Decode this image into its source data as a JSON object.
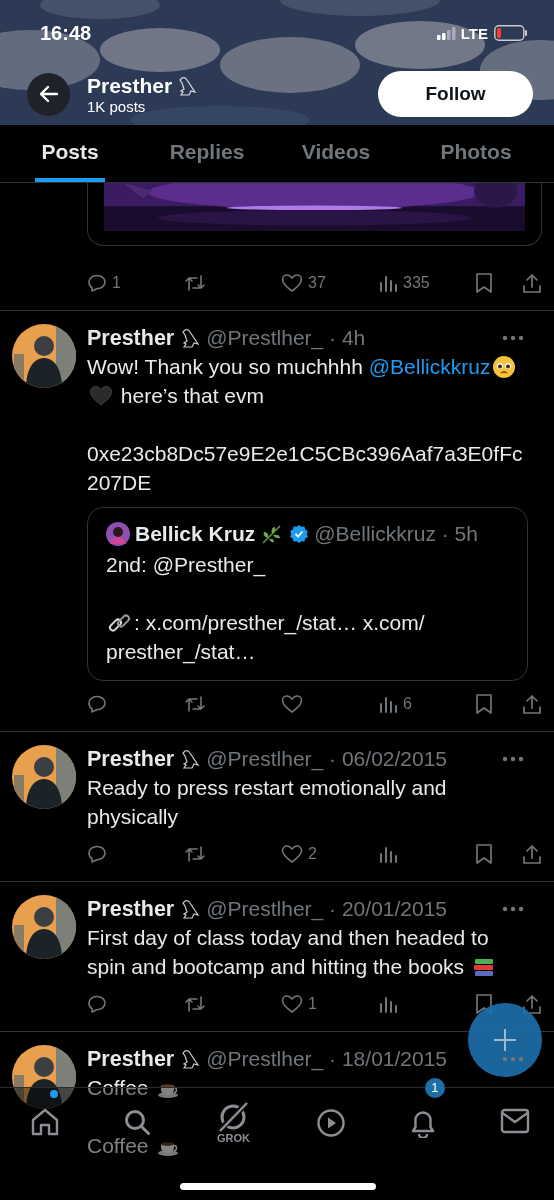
{
  "status_bar": {
    "time": "16:48",
    "network": "LTE"
  },
  "header": {
    "name": "Presther",
    "subtitle": "1K posts",
    "follow_button": "Follow"
  },
  "tabs": [
    {
      "label": "Posts",
      "selected": true
    },
    {
      "label": "Replies",
      "selected": false
    },
    {
      "label": "Videos",
      "selected": false
    },
    {
      "label": "Photos",
      "selected": false
    }
  ],
  "posts": [
    {
      "kind": "media_tail",
      "counts": {
        "reply": "1",
        "like": "37",
        "views": "335"
      }
    },
    {
      "kind": "post",
      "name": "Presther",
      "handle": "@Prestlher_",
      "separator": "·",
      "time": "4h",
      "paragraphs": [
        [
          {
            "kind": "text",
            "text": "Wow! Thank you so muchhhh "
          },
          {
            "kind": "mention",
            "text": "@Bellickkruz"
          },
          {
            "kind": "emoji"
          },
          {
            "kind": "emoji"
          },
          {
            "kind": "text",
            "text": " here’s that evm"
          }
        ],
        [
          {
            "kind": "text",
            "text": "0xe23cb8Dc57e9E2e1C5CBc396Aaf7a3E0fFc207DE"
          }
        ]
      ],
      "quote": {
        "name": "Bellick Kruz",
        "verified": true,
        "handle": "@Bellickkruz",
        "separator": "·",
        "time": "5h",
        "paragraphs": [
          [
            {
              "kind": "text",
              "text": "2nd: @Presther_"
            }
          ],
          [
            {
              "kind": "emoji"
            },
            {
              "kind": "text",
              "text": ": x.com/presther_/stat… x.com/ presther_/stat…"
            }
          ]
        ]
      },
      "counts": {
        "views": "6"
      }
    },
    {
      "kind": "post",
      "name": "Presther",
      "handle": "@Prestlher_",
      "separator": "·",
      "time": "06/02/2015",
      "paragraphs": [
        [
          {
            "kind": "text",
            "text": "Ready to press restart emotionally and physically"
          }
        ]
      ],
      "counts": {
        "like": "2"
      }
    },
    {
      "kind": "post",
      "name": "Presther",
      "handle": "@Prestlher_",
      "separator": "·",
      "time": "20/01/2015",
      "paragraphs": [
        [
          {
            "kind": "text",
            "text": "First day of class today and then headed to spin and bootcamp and hitting the books "
          },
          {
            "kind": "emoji"
          }
        ]
      ],
      "counts": {
        "like": "1"
      }
    },
    {
      "kind": "post",
      "name": "Presther",
      "handle": "@Prestlher_",
      "separator": "·",
      "time": "18/01/2015",
      "paragraphs": [
        [
          {
            "kind": "text",
            "text": "Coffee "
          },
          {
            "kind": "emoji"
          }
        ],
        [
          {
            "kind": "text",
            "text": "Coffee "
          },
          {
            "kind": "emoji"
          }
        ]
      ]
    }
  ],
  "nav": [
    {
      "kind": "home",
      "dot": true
    },
    {
      "kind": "search"
    },
    {
      "kind": "grok",
      "label": "GROK"
    },
    {
      "kind": "video"
    },
    {
      "kind": "bell",
      "badge": "1"
    },
    {
      "kind": "mail"
    }
  ]
}
